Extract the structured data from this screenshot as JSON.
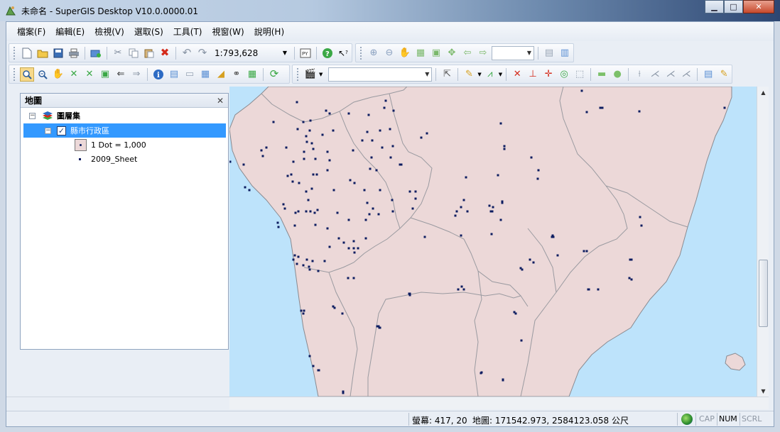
{
  "window": {
    "title": "未命名 - SuperGIS Desktop V10.0.0000.01",
    "buttons": [
      "minimize",
      "maximize",
      "close"
    ]
  },
  "menubar": {
    "items": [
      "檔案(F)",
      "編輯(E)",
      "檢視(V)",
      "選取(S)",
      "工具(T)",
      "視窗(W)",
      "說明(H)"
    ]
  },
  "toolbar": {
    "scale": "1:793,628",
    "row1_icons": [
      "new-icon",
      "open-icon",
      "save-icon",
      "print-icon",
      "add-data-icon",
      "cut-icon",
      "copy-icon",
      "paste-icon",
      "delete-icon",
      "undo-icon",
      "redo-icon",
      "python-icon",
      "help-icon",
      "whats-this-icon",
      "fixed-zoom-in-icon",
      "fixed-zoom-out-icon",
      "pan-layout-icon",
      "zoom-whole-page-icon",
      "zoom-100-icon",
      "full-extent-icon",
      "back-icon",
      "forward-icon"
    ],
    "row2_icons": [
      "zoom-in-icon",
      "zoom-out-icon",
      "pan-icon",
      "full-extent-icon",
      "full-extent-alt-icon",
      "zoom-layer-icon",
      "back-icon",
      "forward-icon",
      "identify-icon",
      "find-icon",
      "measure-icon",
      "select-features-icon",
      "bookmark-icon",
      "hyperlink-icon",
      "table-icon",
      "refresh-icon",
      "animation-icon",
      "edit-tool-icon",
      "sketch-icon",
      "snap-icon",
      "vertex-icon",
      "edit-line-icon",
      "target-icon",
      "select-box-icon",
      "rectangle-icon",
      "circle-icon",
      "split-icon",
      "merge-icon",
      "reshape-icon",
      "union-icon",
      "attributes-icon",
      "sketch-properties-icon"
    ]
  },
  "toc": {
    "title": "地圖",
    "map_frame": "圖層集",
    "layer_name": "縣市行政區",
    "legend_label": "1 Dot = 1,000",
    "field_name": "2009_Sheet"
  },
  "statusbar": {
    "screen_coords": "螢幕: 417, 20",
    "map_coords": "地圖: 171542.973, 2584123.058 公尺",
    "keys": [
      "CAP",
      "NUM",
      "SCRL"
    ],
    "num_on": true
  },
  "colors": {
    "sea": "#bde3fb",
    "land": "#ecd8d8",
    "boundary": "#9a9aa0",
    "dot": "#0c1c60",
    "selection": "#3399ff"
  }
}
